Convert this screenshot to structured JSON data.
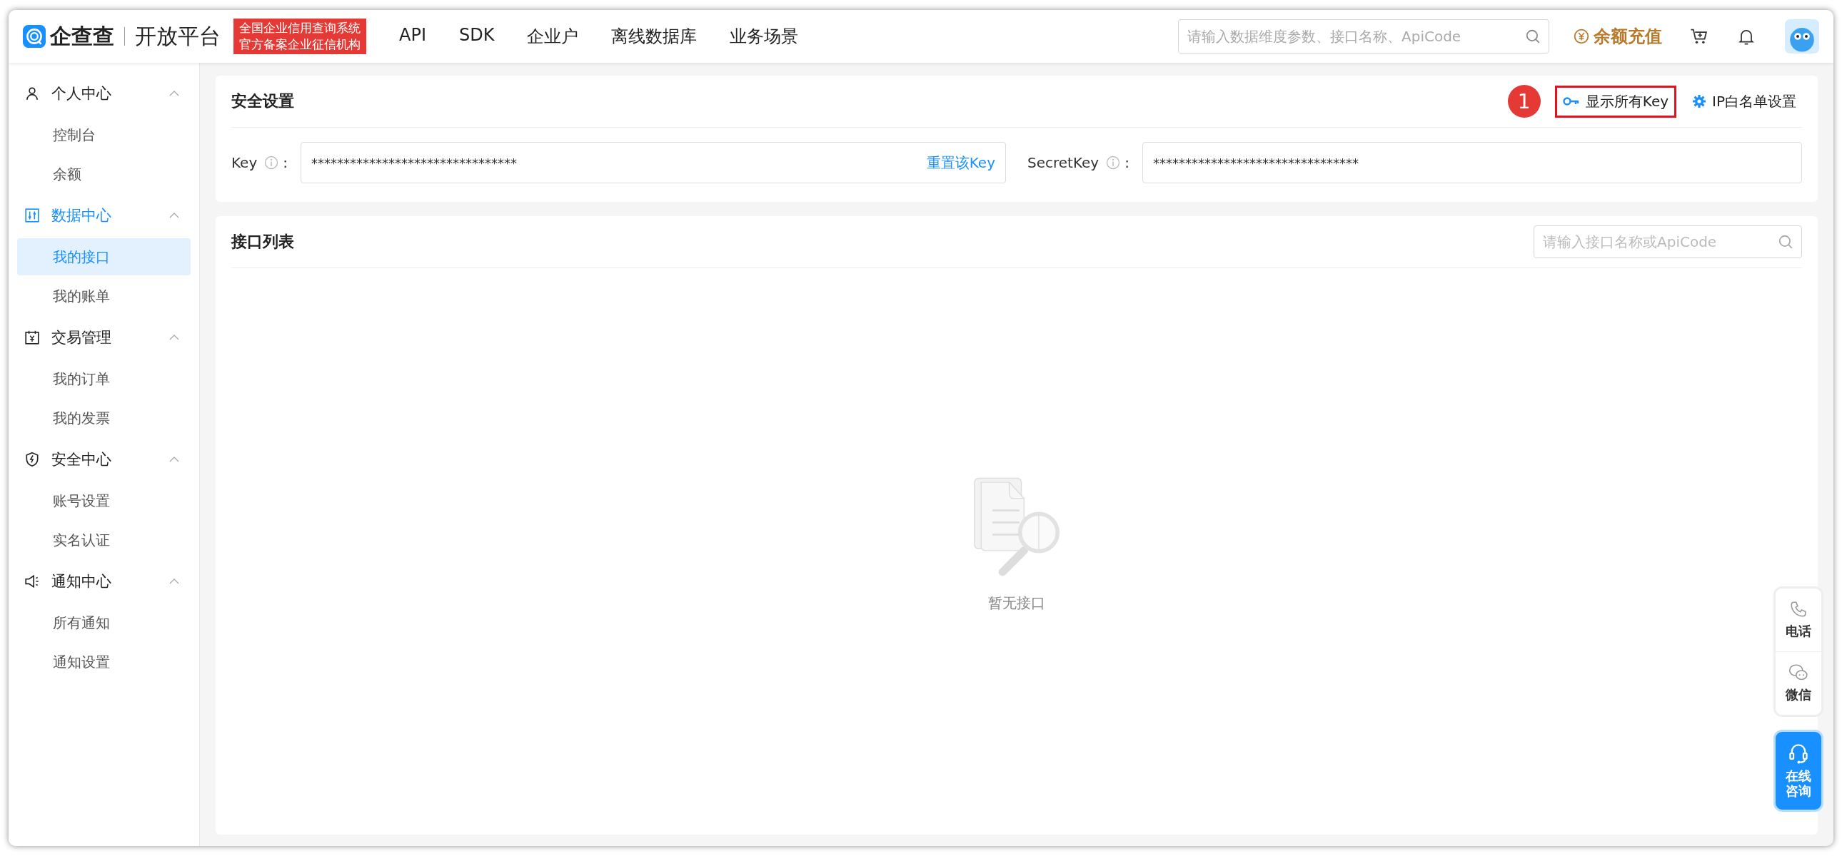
{
  "header": {
    "logo_text": "企查查",
    "product": "开放平台",
    "badge_lines": [
      "全国企业信用查询系统",
      "官方备案企业征信机构"
    ],
    "nav": [
      {
        "label": "API"
      },
      {
        "label": "SDK"
      },
      {
        "label": "企业户"
      },
      {
        "label": "离线数据库"
      },
      {
        "label": "业务场景"
      }
    ],
    "search": {
      "placeholder": "请输入数据维度参数、接口名称、ApiCode"
    },
    "recharge": "余额充值"
  },
  "sidebar": {
    "groups": [
      {
        "label": "个人中心",
        "kind": "person",
        "expanded": true,
        "items": [
          {
            "label": "控制台",
            "selected": false
          },
          {
            "label": "余额",
            "selected": false
          }
        ]
      },
      {
        "label": "数据中心",
        "kind": "data",
        "expanded": true,
        "items": [
          {
            "label": "我的接口",
            "selected": true
          },
          {
            "label": "我的账单",
            "selected": false
          }
        ]
      },
      {
        "label": "交易管理",
        "kind": "trade",
        "expanded": true,
        "items": [
          {
            "label": "我的订单",
            "selected": false
          },
          {
            "label": "我的发票",
            "selected": false
          }
        ]
      },
      {
        "label": "安全中心",
        "kind": "shield",
        "expanded": true,
        "items": [
          {
            "label": "账号设置",
            "selected": false
          },
          {
            "label": "实名认证",
            "selected": false
          }
        ]
      },
      {
        "label": "通知中心",
        "kind": "speaker",
        "expanded": true,
        "items": [
          {
            "label": "所有通知",
            "selected": false
          },
          {
            "label": "通知设置",
            "selected": false
          }
        ]
      }
    ]
  },
  "security": {
    "title": "安全设置",
    "show_keys": {
      "label": "显示所有Key",
      "highlighted": true,
      "callout": "1"
    },
    "ip_whitelist": "IP白名单设置",
    "fields": [
      {
        "label": "Key",
        "colon": ":",
        "value": "********************************",
        "action": "重置该Key"
      },
      {
        "label": "SecretKey",
        "colon": ":",
        "value": "********************************"
      }
    ]
  },
  "interfaces": {
    "title": "接口列表",
    "search": {
      "placeholder": "请输入接口名称或ApiCode"
    },
    "empty_text": "暂无接口"
  },
  "float_buttons": [
    {
      "kind": "phone",
      "label": "电话"
    },
    {
      "kind": "wechat",
      "label": "微信"
    },
    {
      "kind": "consult",
      "label": "在线咨询"
    }
  ]
}
